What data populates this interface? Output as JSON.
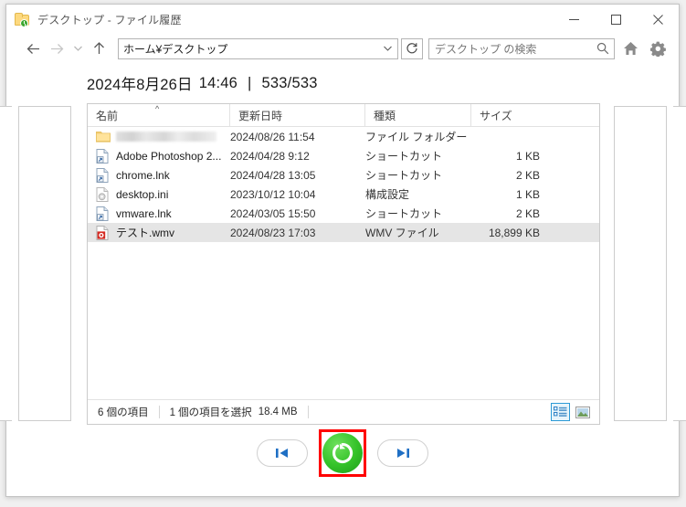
{
  "window": {
    "title": "デスクトップ - ファイル履歴",
    "icon": "folder-history-icon",
    "minimize_label": "最小化",
    "maximize_label": "最大化",
    "close_label": "閉じる"
  },
  "toolbar": {
    "back_label": "戻る",
    "forward_label": "進む",
    "recent_label": "最近表示した場所",
    "up_label": "上へ",
    "address_value": "ホーム¥デスクトップ",
    "address_dropdown_label": "以前の場所",
    "refresh_label": "更新",
    "search_placeholder": "デスクトップ の検索",
    "home_label": "ホーム",
    "settings_label": "設定"
  },
  "header": {
    "date": "2024年8月26日",
    "time": "14:46",
    "separator": "|",
    "counter": "533/533"
  },
  "columns": [
    {
      "label": "名前",
      "sort": "^"
    },
    {
      "label": "更新日時",
      "sort": ""
    },
    {
      "label": "種類",
      "sort": ""
    },
    {
      "label": "サイズ",
      "sort": ""
    }
  ],
  "files": [
    {
      "name": "",
      "redacted": true,
      "icon": "folder-icon",
      "date": "2024/08/26 11:54",
      "type": "ファイル フォルダー",
      "size": "",
      "selected": false
    },
    {
      "name": "Adobe Photoshop 2...",
      "redacted": false,
      "icon": "shortcut-icon",
      "date": "2024/04/28 9:12",
      "type": "ショートカット",
      "size": "1 KB",
      "selected": false
    },
    {
      "name": "chrome.lnk",
      "redacted": false,
      "icon": "shortcut-icon",
      "date": "2024/04/28 13:05",
      "type": "ショートカット",
      "size": "2 KB",
      "selected": false
    },
    {
      "name": "desktop.ini",
      "redacted": false,
      "icon": "config-icon",
      "date": "2023/10/12 10:04",
      "type": "構成設定",
      "size": "1 KB",
      "selected": false
    },
    {
      "name": "vmware.lnk",
      "redacted": false,
      "icon": "shortcut-icon",
      "date": "2024/03/05 15:50",
      "type": "ショートカット",
      "size": "2 KB",
      "selected": false
    },
    {
      "name": "テスト.wmv",
      "redacted": false,
      "icon": "video-icon",
      "date": "2024/08/23 17:03",
      "type": "WMV ファイル",
      "size": "18,899 KB",
      "selected": true
    }
  ],
  "statusbar": {
    "item_count": "6 個の項目",
    "selection": "1 個の項目を選択",
    "selection_size": "18.4 MB",
    "details_view_label": "詳細",
    "large_icons_view_label": "大アイコン"
  },
  "bottomnav": {
    "previous_label": "前のバージョン",
    "restore_label": "元の場所に復元",
    "next_label": "次のバージョン"
  },
  "colors": {
    "restore_green": "#35c32a",
    "highlight_red": "#ff0000",
    "accent_blue": "#2c9ad6",
    "selection_gray": "#e5e5e5"
  }
}
